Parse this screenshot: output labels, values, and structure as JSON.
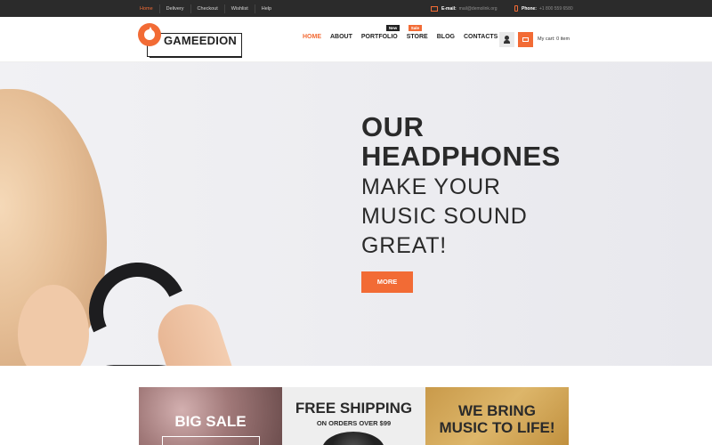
{
  "topbar": {
    "links": [
      "Home",
      "Delivery",
      "Checkout",
      "Wishlist",
      "Help"
    ],
    "email_label": "E-mail:",
    "email_value": "mail@demolink.org",
    "phone_label": "Phone:",
    "phone_value": "+1 800 559 6580"
  },
  "header": {
    "logo_text": "GAMEEDION",
    "nav": [
      "HOME",
      "ABOUT",
      "PORTFOLIO",
      "STORE",
      "BLOG",
      "CONTACTS"
    ],
    "badge_new": "New",
    "badge_sale": "Sale",
    "cart_text": "My cart: 0 item"
  },
  "hero": {
    "title_line1": "OUR",
    "title_line2": "HEADPHONES",
    "sub_line1": "MAKE YOUR",
    "sub_line2": "MUSIC SOUND",
    "sub_line3": "GREAT!",
    "button": "MORE"
  },
  "banners": {
    "b1_text": "BIG SALE",
    "b2_title": "FREE SHIPPING",
    "b2_sub": "ON ORDERS OVER $99",
    "b3_line1": "WE BRING",
    "b3_line2": "MUSIC TO LIFE!"
  },
  "colors": {
    "accent": "#f26b35",
    "dark": "#2b2b2b"
  }
}
